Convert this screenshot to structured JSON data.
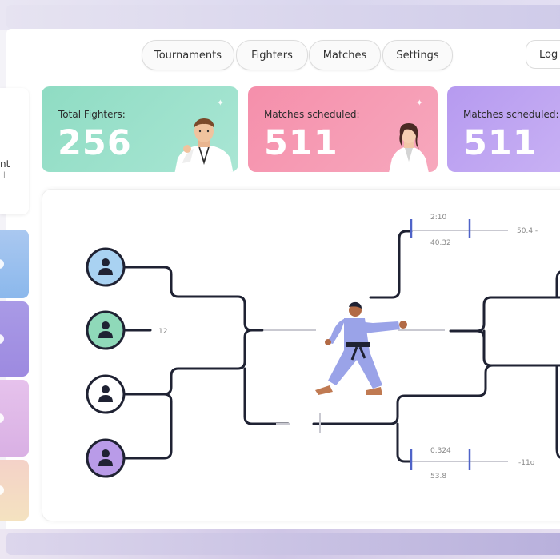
{
  "nav": {
    "items": [
      "Tournaments",
      "Fighters",
      "Matches",
      "Settings"
    ],
    "login_label": "Log i"
  },
  "left_card": {
    "title": "nt",
    "sub": "l"
  },
  "stats": [
    {
      "label": "Total Fighters:",
      "value": "256",
      "color": "#8fdcc3"
    },
    {
      "label": "Matches scheduled:",
      "value": "511",
      "color": "#f58fab"
    },
    {
      "label": "Matches scheduled:",
      "value": "511",
      "color": "#b69af0"
    }
  ],
  "bracket": {
    "top_match": {
      "time": "2:10",
      "score_a": "40.32",
      "score_b": "50.4 -"
    },
    "mid_label": "12",
    "bottom_match": {
      "time": "0.324",
      "score_a": "53.8",
      "score_b": "-11o"
    }
  },
  "fighter_colors": [
    "#a9d2f2",
    "#8fd9b9",
    "#ffffff",
    "#b99be8"
  ]
}
